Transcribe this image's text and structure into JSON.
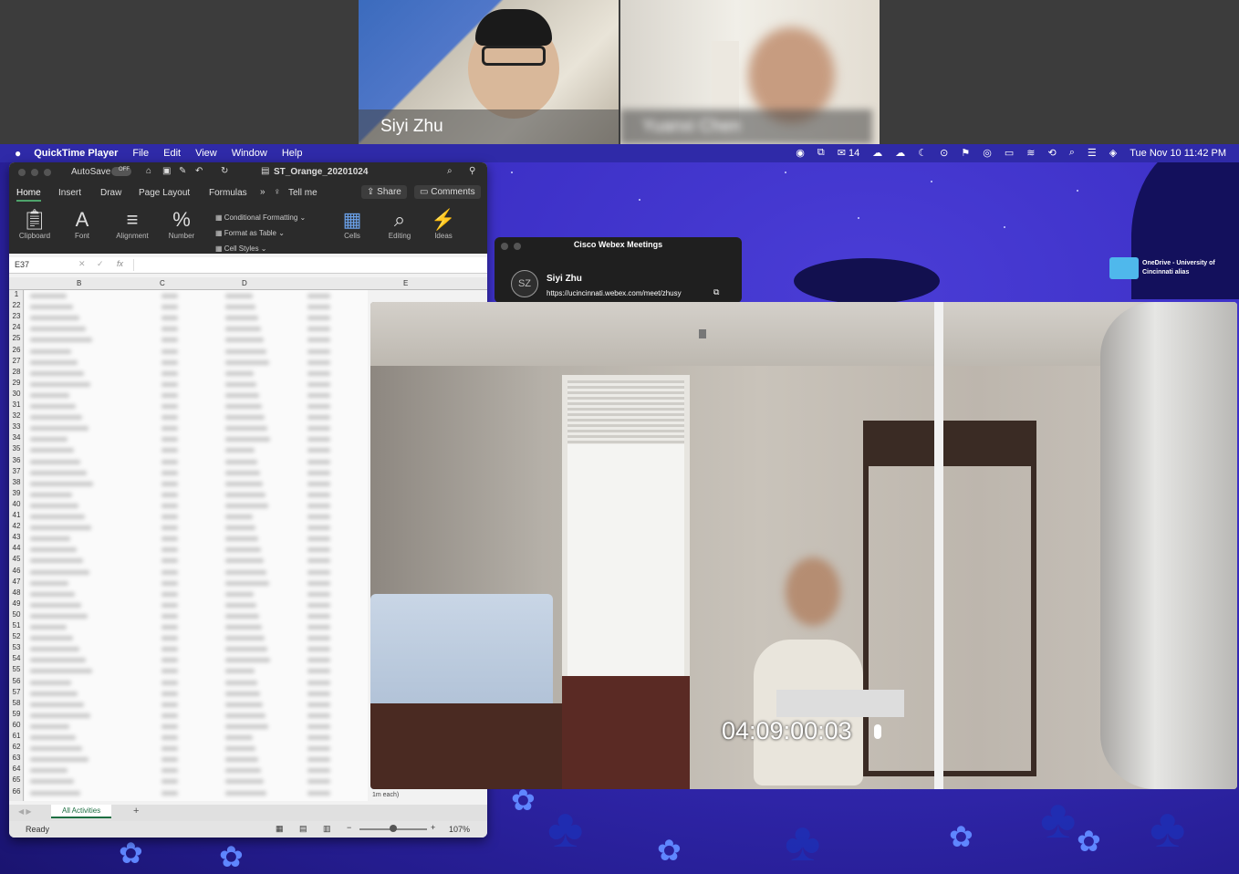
{
  "call": {
    "participants": [
      {
        "name": "Siyi Zhu"
      },
      {
        "name": "Yuanxi Chen"
      }
    ]
  },
  "menubar": {
    "apple": "",
    "app": "QuickTime Player",
    "items": [
      "File",
      "Edit",
      "View",
      "Window",
      "Help"
    ],
    "notification_count": "14",
    "datetime": "Tue Nov 10  11:42 PM"
  },
  "excel": {
    "autosave": "AutoSave",
    "autosave_state": "OFF",
    "filename": "ST_Orange_20201024",
    "tabs": [
      "Home",
      "Insert",
      "Draw",
      "Page Layout",
      "Formulas"
    ],
    "tell_me": "Tell me",
    "share": "Share",
    "comments": "Comments",
    "tools": {
      "clipboard": "Clipboard",
      "font": "Font",
      "alignment": "Alignment",
      "number": "Number",
      "cond_format": "Conditional Formatting",
      "format_table": "Format as Table",
      "cell_styles": "Cell Styles",
      "cells": "Cells",
      "editing": "Editing",
      "ideas": "Ideas"
    },
    "name_box": "E37",
    "fx": "fx",
    "columns": [
      "B",
      "C",
      "D",
      "E"
    ],
    "rows": [
      "1",
      "22",
      "23",
      "24",
      "25",
      "26",
      "27",
      "28",
      "29",
      "30",
      "31",
      "32",
      "33",
      "34",
      "35",
      "36",
      "37",
      "38",
      "39",
      "40",
      "41",
      "42",
      "43",
      "44",
      "45",
      "46",
      "47",
      "48",
      "49",
      "50",
      "51",
      "52",
      "53",
      "54",
      "55",
      "56",
      "57",
      "58",
      "59",
      "60",
      "61",
      "62",
      "63",
      "64",
      "65",
      "66"
    ],
    "sheet_tab": "All Activities",
    "status": "Ready",
    "zoom": "107%",
    "cell_note": "1m each)"
  },
  "webex": {
    "title": "Cisco Webex Meetings",
    "avatar": "SZ",
    "host": "Siyi Zhu",
    "url": "https://ucincinnati.webex.com/meet/zhusy"
  },
  "desktop": {
    "onedrive": "OneDrive - University of Cincinnati alias"
  },
  "video": {
    "timestamp": "04:09:00:03"
  }
}
